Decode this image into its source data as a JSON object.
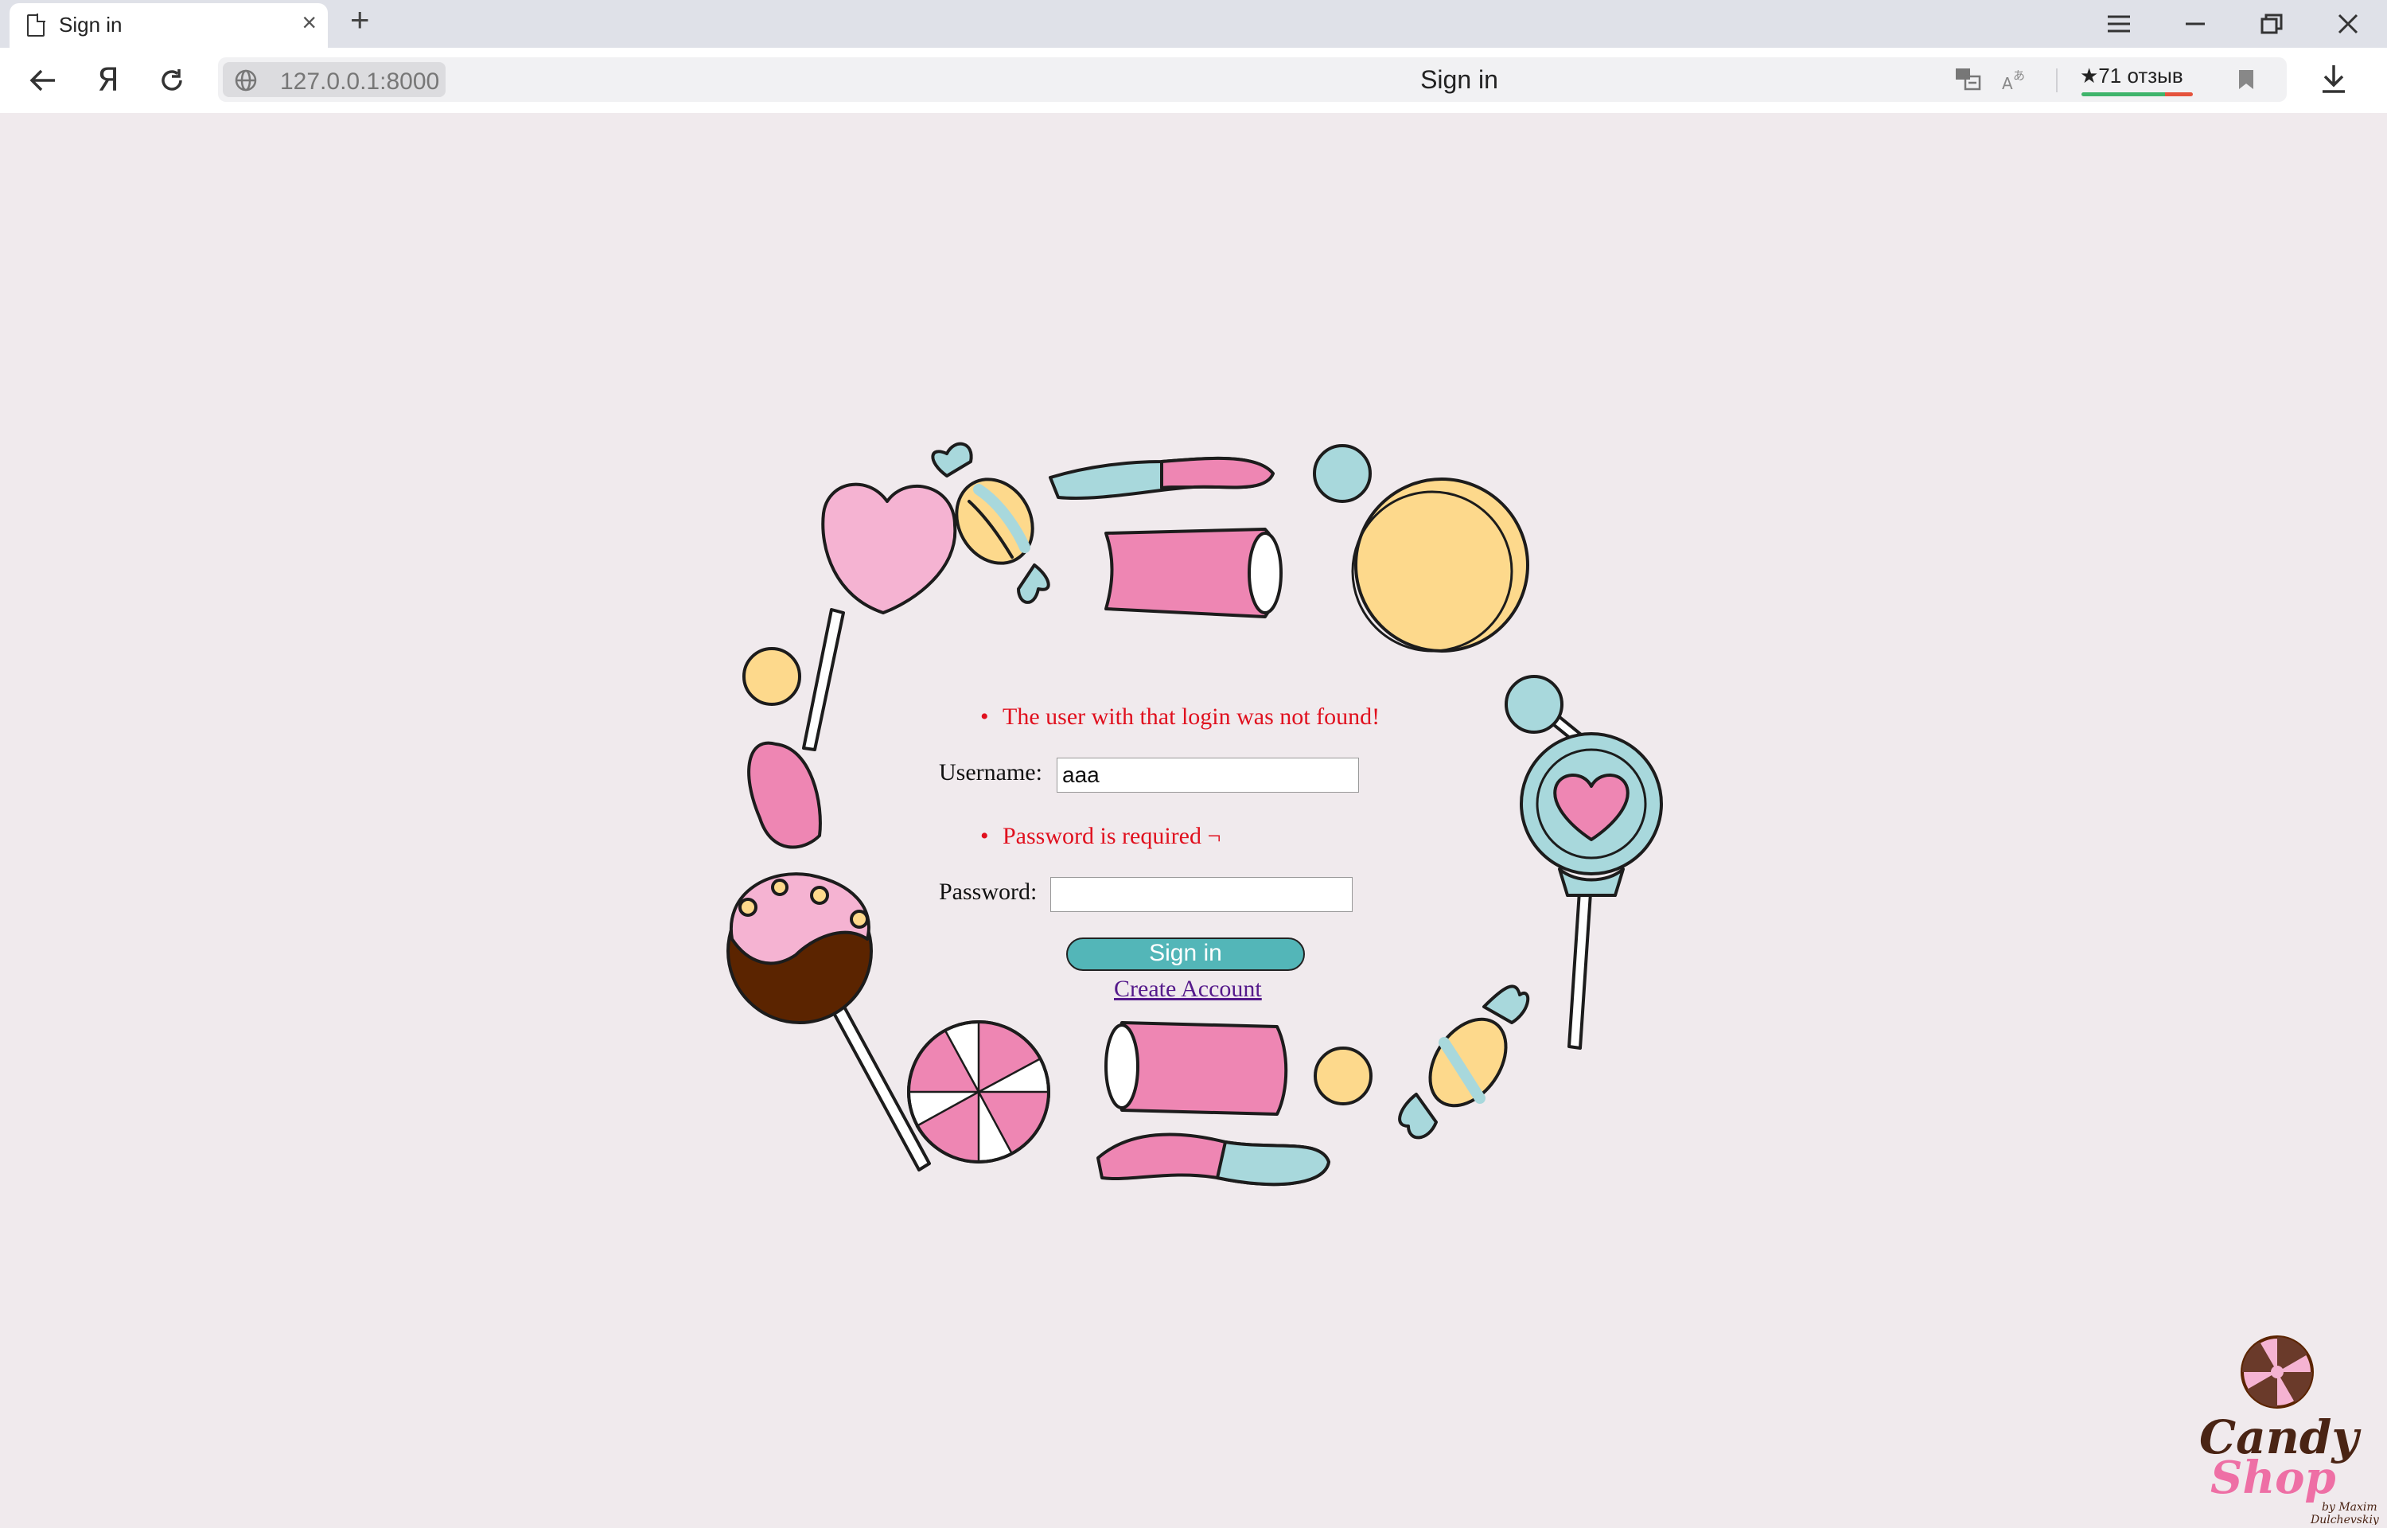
{
  "browser": {
    "tab_title": "Sign in",
    "address_url": "127.0.0.1:8000",
    "address_title": "Sign in",
    "reviews_label": "★71 отзыв"
  },
  "form": {
    "login_error": "The user with that login was not found!",
    "username_label": "Username:",
    "username_value": "aaa",
    "password_error": "Password is required ¬",
    "password_label": "Password:",
    "password_value": "",
    "signin_button": "Sign in",
    "create_account_link": "Create Account"
  },
  "logo": {
    "title_line1": "Candy",
    "title_line2": "Shop",
    "byline1": "by Maxim",
    "byline2": "Dulchevskiy"
  },
  "colors": {
    "background": "#f0eaed",
    "error": "#e0101e",
    "button": "#53b6b8",
    "link": "#551a8b",
    "candy_pink": "#ee86b3",
    "candy_blue": "#a8d8dc",
    "candy_yellow": "#fdd98c"
  }
}
